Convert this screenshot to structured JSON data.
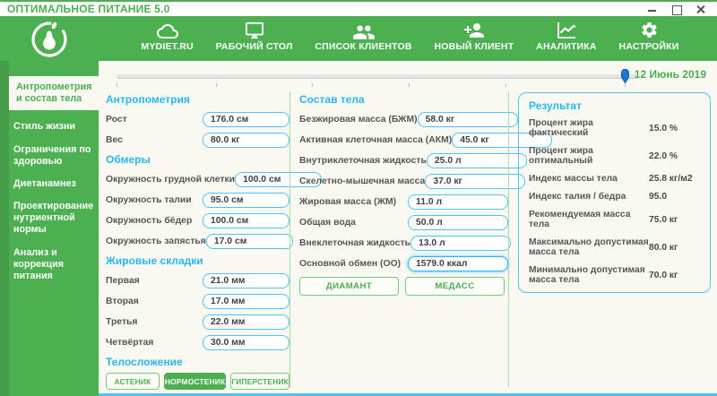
{
  "colors": {
    "green": "#4caf50",
    "cyan_header": "#29b6f6",
    "input_border": "#4fc3f7",
    "slider_handle": "#1976d2",
    "background": "#faf9f1"
  },
  "window": {
    "title": "ОПТИМАЛЬНОЕ ПИТАНИЕ 5.0"
  },
  "nav": {
    "items": [
      {
        "label": "MYDIET.RU",
        "icon": "cloud-icon"
      },
      {
        "label": "РАБОЧИЙ СТОЛ",
        "icon": "monitor-icon"
      },
      {
        "label": "СПИСОК КЛИЕНТОВ",
        "icon": "people-icon"
      },
      {
        "label": "НОВЫЙ КЛИЕНТ",
        "icon": "person-add-icon"
      },
      {
        "label": "АНАЛИТИКА",
        "icon": "chart-icon"
      },
      {
        "label": "НАСТРОЙКИ",
        "icon": "gear-icon"
      }
    ]
  },
  "sidebar": {
    "items": [
      {
        "label": "Антропометрия и состав тела",
        "active": true
      },
      {
        "label": "Стиль жизни",
        "active": false
      },
      {
        "label": "Ограничения по здоровью",
        "active": false
      },
      {
        "label": "Диетанамнез",
        "active": false
      },
      {
        "label": "Проектирование нутриентной нормы",
        "active": false
      },
      {
        "label": "Анализ и коррекция питания",
        "active": false
      }
    ]
  },
  "timeline": {
    "date": "12 Июнь 2019"
  },
  "anthropometry": {
    "title": "Антропометрия",
    "fields": [
      {
        "label": "Рост",
        "value": "176.0 см"
      },
      {
        "label": "Вес",
        "value": "80.0 кг"
      }
    ]
  },
  "girths": {
    "title": "Обмеры",
    "fields": [
      {
        "label": "Окружность грудной клетки",
        "value": "100.0 см"
      },
      {
        "label": "Окружность талии",
        "value": "95.0 см"
      },
      {
        "label": "Окружность бёдер",
        "value": "100.0 см"
      },
      {
        "label": "Окружность запястья",
        "value": "17.0 см"
      }
    ]
  },
  "skinfolds": {
    "title": "Жировые складки",
    "fields": [
      {
        "label": "Первая",
        "value": "21.0 мм"
      },
      {
        "label": "Вторая",
        "value": "17.0 мм"
      },
      {
        "label": "Третья",
        "value": "22.0 мм"
      },
      {
        "label": "Четвёртая",
        "value": "30.0 мм"
      }
    ]
  },
  "body_type": {
    "title": "Телосложение",
    "options": [
      {
        "label": "АСТЕНИК",
        "selected": false
      },
      {
        "label": "НОРМОСТЕНИК",
        "selected": true
      },
      {
        "label": "ГИПЕРСТЕНИК",
        "selected": false
      }
    ]
  },
  "composition": {
    "title": "Состав тела",
    "fields": [
      {
        "label": "Безжировая масса (БЖМ)",
        "value": "58.0 кг"
      },
      {
        "label": "Активная клеточная масса (АКМ)",
        "value": "45.0 кг"
      },
      {
        "label": "Внутриклеточная жидкость",
        "value": "25.0 л"
      },
      {
        "label": "Скелетно-мышечная масса",
        "value": "37.0 кг"
      },
      {
        "label": "Жировая масса (ЖМ)",
        "value": "11.0 л"
      },
      {
        "label": "Общая вода",
        "value": "50.0 л"
      },
      {
        "label": "Внеклеточная жидкость",
        "value": "13.0 л"
      },
      {
        "label": "Основной обмен (ОО)",
        "value": "1579.0 ккал"
      }
    ],
    "buttons": [
      {
        "label": "ДИАМАНТ"
      },
      {
        "label": "МЕДАСС"
      }
    ]
  },
  "results": {
    "title": "Результат",
    "rows": [
      {
        "label": "Процент жира фактический",
        "value": "15.0 %"
      },
      {
        "label": "Процент жира оптимальный",
        "value": "22.0 %"
      },
      {
        "label": "Индекс массы тела",
        "value": "25.8 кг/м2"
      },
      {
        "label": "Индекс талия / бедра",
        "value": "95.0"
      },
      {
        "label": "Рекомендуемая масса тела",
        "value": "75.0 кг"
      },
      {
        "label": "Максимально допустимая масса тела",
        "value": "80.0 кг"
      },
      {
        "label": "Минимально допустимая масса тела",
        "value": "70.0 кг"
      }
    ]
  }
}
